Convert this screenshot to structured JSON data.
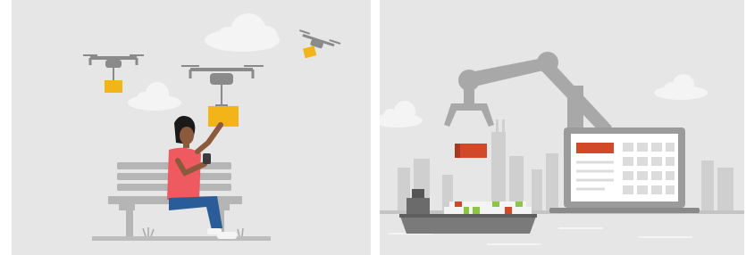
{
  "colors": {
    "background": "#e6e6e6",
    "cloud": "#f4f4f4",
    "drone": "#8a8a8a",
    "package": "#f2b417",
    "shirt": "#ee5a5f",
    "jeans": "#2a5c9a",
    "skin": "#8b5a3c",
    "hair": "#1a1a1a",
    "bench": "#b5b5b5",
    "robot_arm": "#a8a8a8",
    "accent_red": "#d2492a",
    "skyline": "#cfcfcf",
    "ship_hull": "#7a7a7a",
    "laptop": "#9b9b9b",
    "green_cargo": "#8cc63f"
  },
  "panels": [
    {
      "name": "drone-delivery-illustration"
    },
    {
      "name": "smart-factory-shipping-illustration"
    }
  ]
}
